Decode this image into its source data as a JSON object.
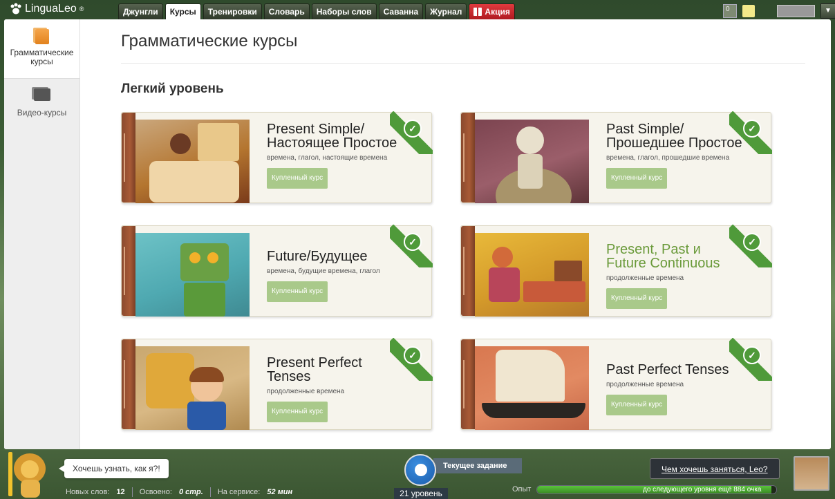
{
  "app": {
    "logo": "LinguaLeo",
    "logo_mark": "®"
  },
  "nav": {
    "tabs": [
      "Джунгли",
      "Курсы",
      "Тренировки",
      "Словарь",
      "Наборы слов",
      "Саванна",
      "Журнал"
    ],
    "promo": "Акция",
    "active": "Курсы"
  },
  "topright": {
    "notif_count": "0"
  },
  "sidebar": {
    "items": [
      {
        "label": "Грамматические курсы"
      },
      {
        "label": "Видео-курсы"
      }
    ]
  },
  "main": {
    "title": "Грамматические курсы",
    "level": "Легкий уровень"
  },
  "courses": [
    {
      "title": "Present Simple/ Настоящее Простое",
      "tags": "времена, глагол, настоящие времена",
      "button": "Купленный курс",
      "purchased": true,
      "highlight": false
    },
    {
      "title": "Past Simple/ Прошедшее Простое",
      "tags": "времена, глагол, прошедшие времена",
      "button": "Купленный курс",
      "purchased": true,
      "highlight": false
    },
    {
      "title": "Future/Будущее",
      "tags": "времена, будущие времена, глагол",
      "button": "Купленный курс",
      "purchased": true,
      "highlight": false
    },
    {
      "title": "Present, Past и Future Continuous",
      "tags": "продолженные времена",
      "button": "Купленный курс",
      "purchased": true,
      "highlight": true
    },
    {
      "title": "Present Perfect Tenses",
      "tags": "продолженные времена",
      "button": "Купленный курс",
      "purchased": true,
      "highlight": false
    },
    {
      "title": "Past Perfect Tenses",
      "tags": "продолженные времена",
      "button": "Купленный курс",
      "purchased": true,
      "highlight": false
    }
  ],
  "bottom": {
    "speech": "Хочешь узнать, как я?!",
    "stats": {
      "new_label": "Новых слов:",
      "new_value": "12",
      "learned_label": "Освоено:",
      "learned_value": "0 стр.",
      "service_label": "На сервисе:",
      "service_value": "52 мин"
    },
    "task": "Текущее задание",
    "level": "21 уровень",
    "offer": "Чем хочешь заняться, Leo?",
    "exp_label": "Опыт",
    "exp_text": "до следующего уровня ещё 884 очка",
    "exp_progress": 0.98
  },
  "colors": {
    "accent": "#4f9a3a",
    "promo": "#d02a30",
    "buy": "#a9c98a"
  }
}
